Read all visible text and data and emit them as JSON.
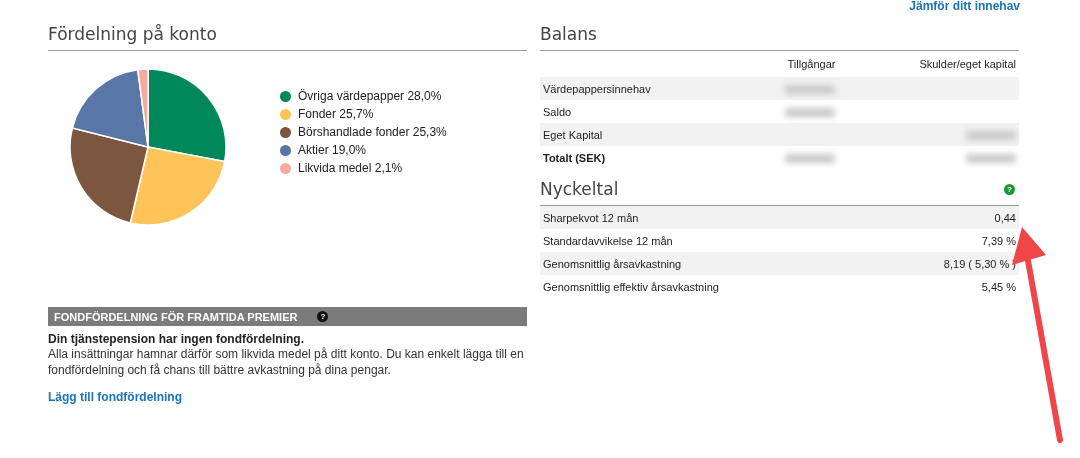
{
  "top_link": "Jämför ditt innehav",
  "distribution": {
    "title": "Fördelning på konto",
    "chart_data": {
      "type": "pie",
      "values": [
        28.0,
        25.7,
        25.3,
        19.0,
        2.1
      ],
      "colors": [
        "#00875a",
        "#fec45a",
        "#7d5640",
        "#5877a6",
        "#f6a99c"
      ]
    },
    "legend": [
      {
        "label": "Övriga värdepapper 28,0%",
        "color": "#00875a"
      },
      {
        "label": "Fonder 25,7%",
        "color": "#fec45a"
      },
      {
        "label": "Börshandlade fonder 25,3%",
        "color": "#7d5640"
      },
      {
        "label": "Aktier 19,0%",
        "color": "#5877a6"
      },
      {
        "label": "Likvida medel 2,1%",
        "color": "#f6a99c"
      }
    ]
  },
  "future_premiums": {
    "header": "FONDFÖRDELNING FÖR FRAMTIDA PREMIER",
    "help": "?",
    "heading": "Din tjänstepension har ingen fondfördelning.",
    "text": "Alla insättningar hamnar därför som likvida medel på ditt konto. Du kan enkelt lägga till en fondfördelning och få chans till bättre avkastning på dina pengar.",
    "link": "Lägg till fondfördelning"
  },
  "balance": {
    "title": "Balans",
    "columns": [
      "Tillgångar",
      "Skulder/eget kapital"
    ],
    "rows": [
      {
        "label": "Värdepappersinnehav",
        "bold": false,
        "assets_redacted": true,
        "liabilities_redacted": false
      },
      {
        "label": "Saldo",
        "bold": false,
        "assets_redacted": true,
        "liabilities_redacted": false
      },
      {
        "label": "Eget Kapital",
        "bold": false,
        "assets_redacted": false,
        "liabilities_redacted": true
      },
      {
        "label": "Totalt (SEK)",
        "bold": true,
        "assets_redacted": true,
        "liabilities_redacted": true
      }
    ]
  },
  "key_figures": {
    "title": "Nyckeltal",
    "help": "?",
    "rows": [
      {
        "label": "Sharpekvot 12 mån",
        "value": "0,44"
      },
      {
        "label": "Standardavvikelse 12 mån",
        "value": "7,39 %"
      },
      {
        "label": "Genomsnittlig årsavkastning",
        "value": "8,19 ( 5,30 % )"
      },
      {
        "label": "Genomsnittlig effektiv årsavkastning",
        "value": "5,45 %"
      }
    ]
  }
}
